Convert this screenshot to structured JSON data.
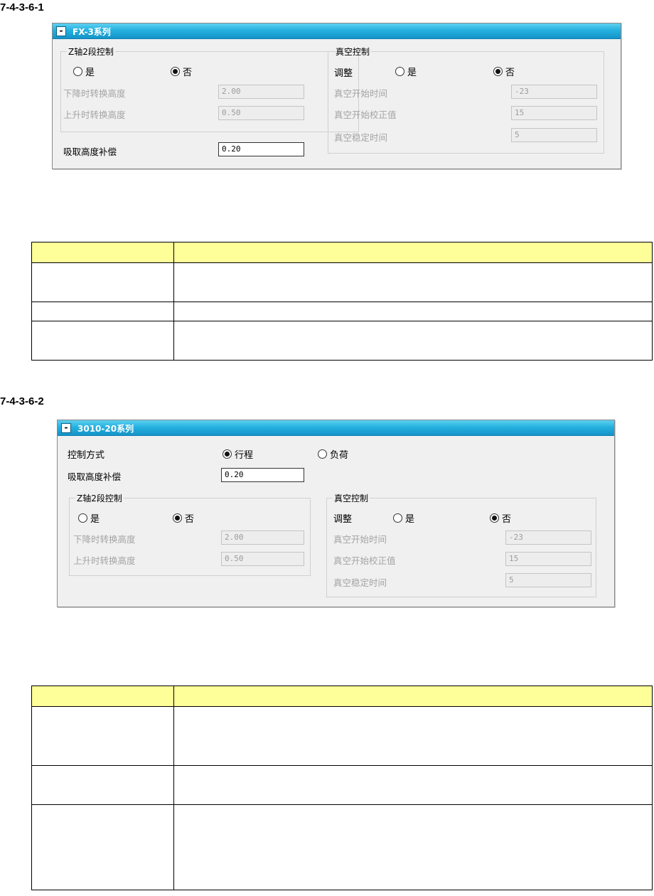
{
  "section1": {
    "heading": "7-4-3-6-1",
    "panel_title": "FX-3系列",
    "collapse_symbol": "-",
    "z_axis": {
      "legend": "Z轴2段控制",
      "yes": "是",
      "no": "否",
      "selected": "否",
      "lower_label": "下降时转换高度",
      "lower_value": "2.00",
      "raise_label": "上升时转换高度",
      "raise_value": "0.50"
    },
    "pickup": {
      "label": "吸取高度补偿",
      "value": "0.20"
    },
    "vacuum": {
      "legend": "真空控制",
      "adjust_label": "调整",
      "yes": "是",
      "no": "否",
      "selected": "否",
      "start_time_label": "真空开始时间",
      "start_time_value": "-23",
      "start_corr_label": "真空开始校正值",
      "start_corr_value": "15",
      "stable_label": "真空稳定时间",
      "stable_value": "5"
    }
  },
  "table1": {
    "header": [
      "",
      ""
    ],
    "rows": [
      [
        "",
        ""
      ],
      [
        "",
        ""
      ],
      [
        "",
        ""
      ]
    ]
  },
  "section2": {
    "heading": "7-4-3-6-2",
    "panel_title": "3010-20系列",
    "collapse_symbol": "-",
    "control_mode": {
      "label": "控制方式",
      "option1": "行程",
      "option2": "负荷",
      "selected": "行程"
    },
    "pickup": {
      "label": "吸取高度补偿",
      "value": "0.20"
    },
    "z_axis": {
      "legend": "Z轴2段控制",
      "yes": "是",
      "no": "否",
      "selected": "否",
      "lower_label": "下降时转换高度",
      "lower_value": "2.00",
      "raise_label": "上升时转换高度",
      "raise_value": "0.50"
    },
    "vacuum": {
      "legend": "真空控制",
      "adjust_label": "调整",
      "yes": "是",
      "no": "否",
      "selected": "否",
      "start_time_label": "真空开始时间",
      "start_time_value": "-23",
      "start_corr_label": "真空开始校正值",
      "start_corr_value": "15",
      "stable_label": "真空稳定时间",
      "stable_value": "5"
    }
  },
  "table2": {
    "header": [
      "",
      ""
    ],
    "rows": [
      [
        "",
        ""
      ],
      [
        "",
        ""
      ],
      [
        "",
        ""
      ]
    ]
  }
}
